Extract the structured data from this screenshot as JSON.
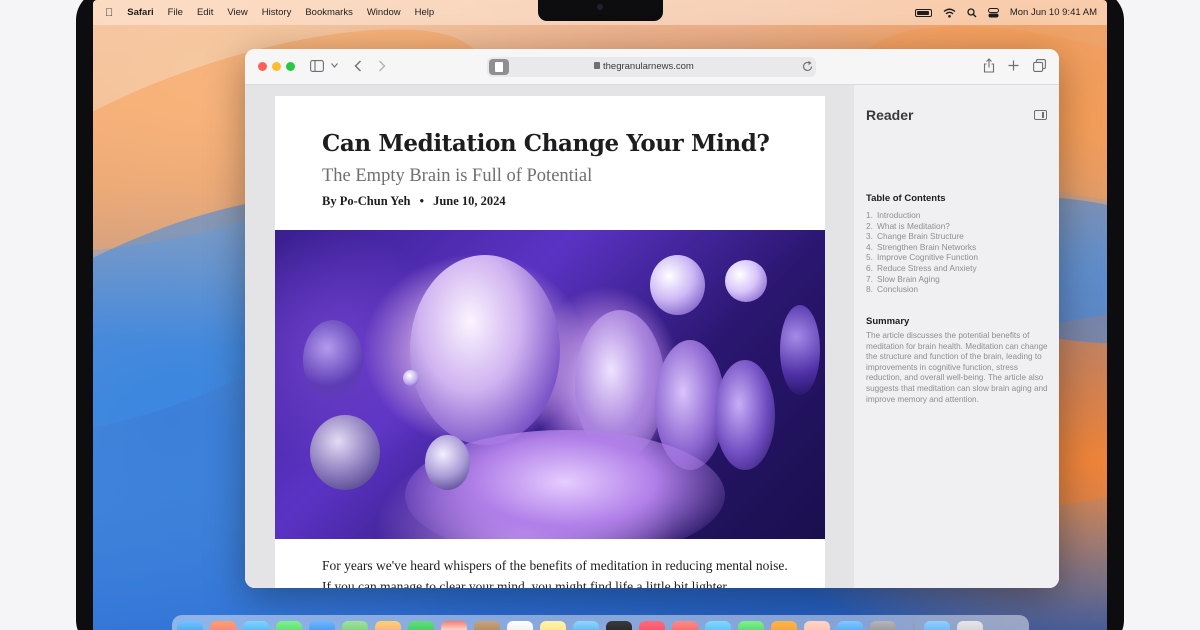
{
  "menubar": {
    "app": "Safari",
    "items": [
      "File",
      "Edit",
      "View",
      "History",
      "Bookmarks",
      "Window",
      "Help"
    ],
    "clock": "Mon Jun 10  9:41 AM"
  },
  "toolbar": {
    "url": "thegranularnews.com"
  },
  "article": {
    "title": "Can Meditation Change Your Mind?",
    "subtitle": "The Empty Brain is Full of Potential",
    "author": "By Po-Chun Yeh",
    "separator": "•",
    "date": "June 10, 2024",
    "body": "For years we've heard whispers of the benefits of meditation in reducing mental noise. If you can manage to clear your mind, you might find life a little bit lighter"
  },
  "reader": {
    "title": "Reader",
    "toc_heading": "Table of Contents",
    "toc": [
      {
        "num": "1.",
        "label": "Introduction"
      },
      {
        "num": "2.",
        "label": "What is Meditation?"
      },
      {
        "num": "3.",
        "label": "Change Brain Structure"
      },
      {
        "num": "4.",
        "label": "Strengthen Brain Networks"
      },
      {
        "num": "5.",
        "label": "Improve Cognitive Function"
      },
      {
        "num": "6.",
        "label": "Reduce Stress and Anxiety"
      },
      {
        "num": "7.",
        "label": "Slow Brain Aging"
      },
      {
        "num": "8.",
        "label": "Conclusion"
      }
    ],
    "summary_heading": "Summary",
    "summary": "The article discusses the potential benefits of meditation for brain health. Meditation can change the structure and function of the brain, leading to improvements in cognitive function, stress reduction, and overall well-being. The article also suggests that meditation can slow brain aging and improve memory and attention."
  },
  "icons": {
    "apple": "apple-logo-icon",
    "sidebar": "sidebar-icon",
    "back": "chevron-left-icon",
    "forward": "chevron-right-icon",
    "reader": "reader-icon",
    "reload": "reload-icon",
    "share": "share-icon",
    "new_tab": "plus-icon",
    "tabs": "tab-overview-icon"
  },
  "colors": {
    "close": "#ff5f57",
    "minimize": "#febc2e",
    "zoom": "#28c840"
  }
}
